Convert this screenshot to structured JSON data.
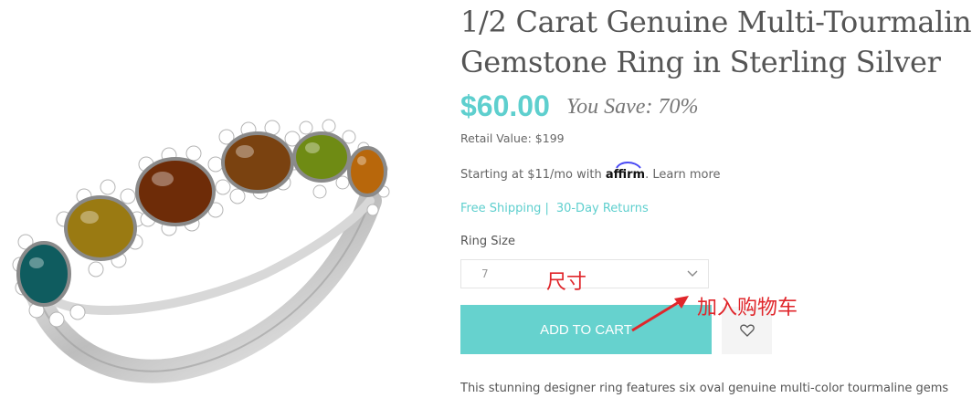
{
  "product": {
    "title_line1": "1/2 Carat Genuine Multi-Tourmaline",
    "title_line2": "Gemstone Ring in Sterling Silver",
    "price": "$60.00",
    "you_save": "You Save: 70%",
    "retail_value": "Retail Value: $199",
    "description": "This stunning designer ring features six oval genuine multi-color tourmaline gems"
  },
  "financing": {
    "prefix": "Starting at $11/mo with",
    "brand": "affirm",
    "suffix": ".",
    "learn_more": "Learn more"
  },
  "shipping": {
    "free_shipping": "Free Shipping",
    "separator": "|",
    "returns": "30-Day Returns"
  },
  "ring_size": {
    "label": "Ring Size",
    "selected": "7"
  },
  "actions": {
    "add_to_cart": "ADD TO CART"
  },
  "annotations": {
    "size_note": "尺寸",
    "cart_note": "加入购物车"
  },
  "colors": {
    "accent": "#5ecfce",
    "button": "#66d2ce",
    "annotation": "#e0262b"
  },
  "icons": {
    "select": "chevron-down-icon",
    "wishlist": "heart-icon",
    "annotation": "arrow-icon"
  }
}
